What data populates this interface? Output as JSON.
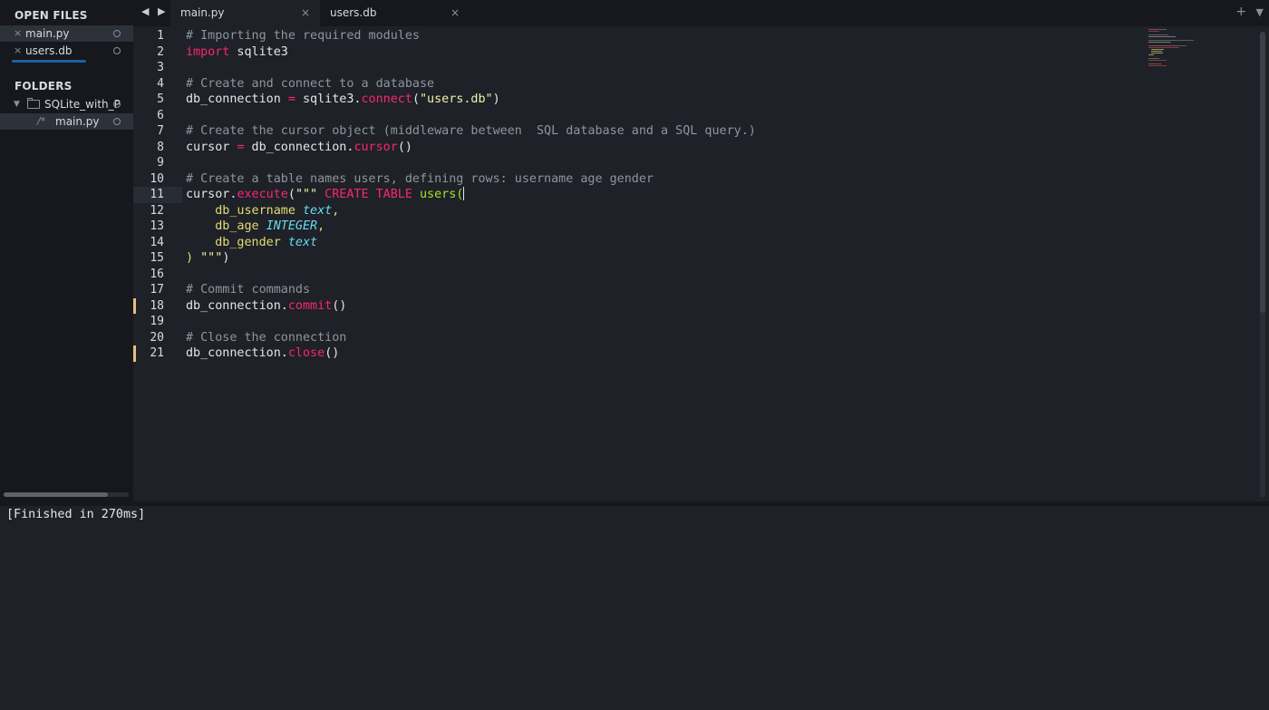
{
  "sidebar": {
    "open_files_heading": "OPEN FILES",
    "open_files": [
      {
        "label": "main.py",
        "close": "×"
      },
      {
        "label": "users.db",
        "close": "×"
      }
    ],
    "folders_heading": "FOLDERS",
    "folder": {
      "label": "SQLite_with_P",
      "expander": "▼"
    },
    "folder_files": [
      {
        "prefix": "/*",
        "label": "main.py"
      }
    ]
  },
  "tabbar": {
    "nav": "◀ ▶",
    "tabs": [
      {
        "label": "main.py",
        "close": "×"
      },
      {
        "label": "users.db",
        "close": "×"
      }
    ],
    "tools": [
      "+",
      "▼"
    ]
  },
  "editor": {
    "current_line": 11,
    "modified_lines": [
      18,
      21
    ],
    "line_numbers": [
      "1",
      "2",
      "3",
      "4",
      "5",
      "6",
      "7",
      "8",
      "9",
      "10",
      "11",
      "12",
      "13",
      "14",
      "15",
      "16",
      "17",
      "18",
      "19",
      "20",
      "21"
    ],
    "lines": [
      [
        {
          "t": "# Importing the required modules",
          "c": "c-comment"
        }
      ],
      [
        {
          "t": "import",
          "c": "c-kw"
        },
        {
          "t": " sqlite3",
          "c": "c-plain"
        }
      ],
      [],
      [
        {
          "t": "# Create and connect to a database",
          "c": "c-comment"
        }
      ],
      [
        {
          "t": "db_connection ",
          "c": "c-plain"
        },
        {
          "t": "=",
          "c": "c-kw"
        },
        {
          "t": " sqlite3.",
          "c": "c-plain"
        },
        {
          "t": "connect",
          "c": "c-func"
        },
        {
          "t": "(",
          "c": "c-plain"
        },
        {
          "t": "\"users.db\"",
          "c": "c-str"
        },
        {
          "t": ")",
          "c": "c-plain"
        }
      ],
      [],
      [
        {
          "t": "# Create the cursor object (middleware between  SQL database and a SQL query.)",
          "c": "c-comment"
        }
      ],
      [
        {
          "t": "cursor ",
          "c": "c-plain"
        },
        {
          "t": "=",
          "c": "c-kw"
        },
        {
          "t": " db_connection.",
          "c": "c-plain"
        },
        {
          "t": "cursor",
          "c": "c-func"
        },
        {
          "t": "()",
          "c": "c-plain"
        }
      ],
      [],
      [
        {
          "t": "# Create a table names users, defining rows: username age gender",
          "c": "c-comment"
        }
      ],
      [
        {
          "t": "cursor.",
          "c": "c-plain"
        },
        {
          "t": "execute",
          "c": "c-func"
        },
        {
          "t": "(",
          "c": "c-plain"
        },
        {
          "t": "\"\"\"",
          "c": "c-str"
        },
        {
          "t": " CREATE TABLE ",
          "c": "c-kw"
        },
        {
          "t": "users(",
          "c": "c-green"
        }
      ],
      [
        {
          "t": "    db_username ",
          "c": "c-field"
        },
        {
          "t": "text",
          "c": "c-type"
        },
        {
          "t": ",",
          "c": "c-field"
        }
      ],
      [
        {
          "t": "    db_age ",
          "c": "c-field"
        },
        {
          "t": "INTEGER",
          "c": "c-type"
        },
        {
          "t": ",",
          "c": "c-field"
        }
      ],
      [
        {
          "t": "    db_gender ",
          "c": "c-field"
        },
        {
          "t": "text",
          "c": "c-type"
        }
      ],
      [
        {
          "t": ")",
          "c": "c-field"
        },
        {
          "t": " \"\"\"",
          "c": "c-str"
        },
        {
          "t": ")",
          "c": "c-plain"
        }
      ],
      [],
      [
        {
          "t": "# Commit commands",
          "c": "c-comment"
        }
      ],
      [
        {
          "t": "db_connection.",
          "c": "c-plain"
        },
        {
          "t": "commit",
          "c": "c-func"
        },
        {
          "t": "()",
          "c": "c-plain"
        }
      ],
      [],
      [
        {
          "t": "# Close the connection",
          "c": "c-comment"
        }
      ],
      [
        {
          "t": "db_connection.",
          "c": "c-plain"
        },
        {
          "t": "close",
          "c": "c-func"
        },
        {
          "t": "()",
          "c": "c-plain"
        }
      ]
    ]
  },
  "output": {
    "text": "[Finished in 270ms]"
  },
  "colors": {
    "background": "#1e2127",
    "sidebar": "#16181d",
    "keyword": "#f92672",
    "comment": "#8f959e",
    "string": "#f1f1ab",
    "type": "#66d9ef",
    "accent_underline": "#1c5fa3",
    "modified_marker": "#e5c07b"
  }
}
